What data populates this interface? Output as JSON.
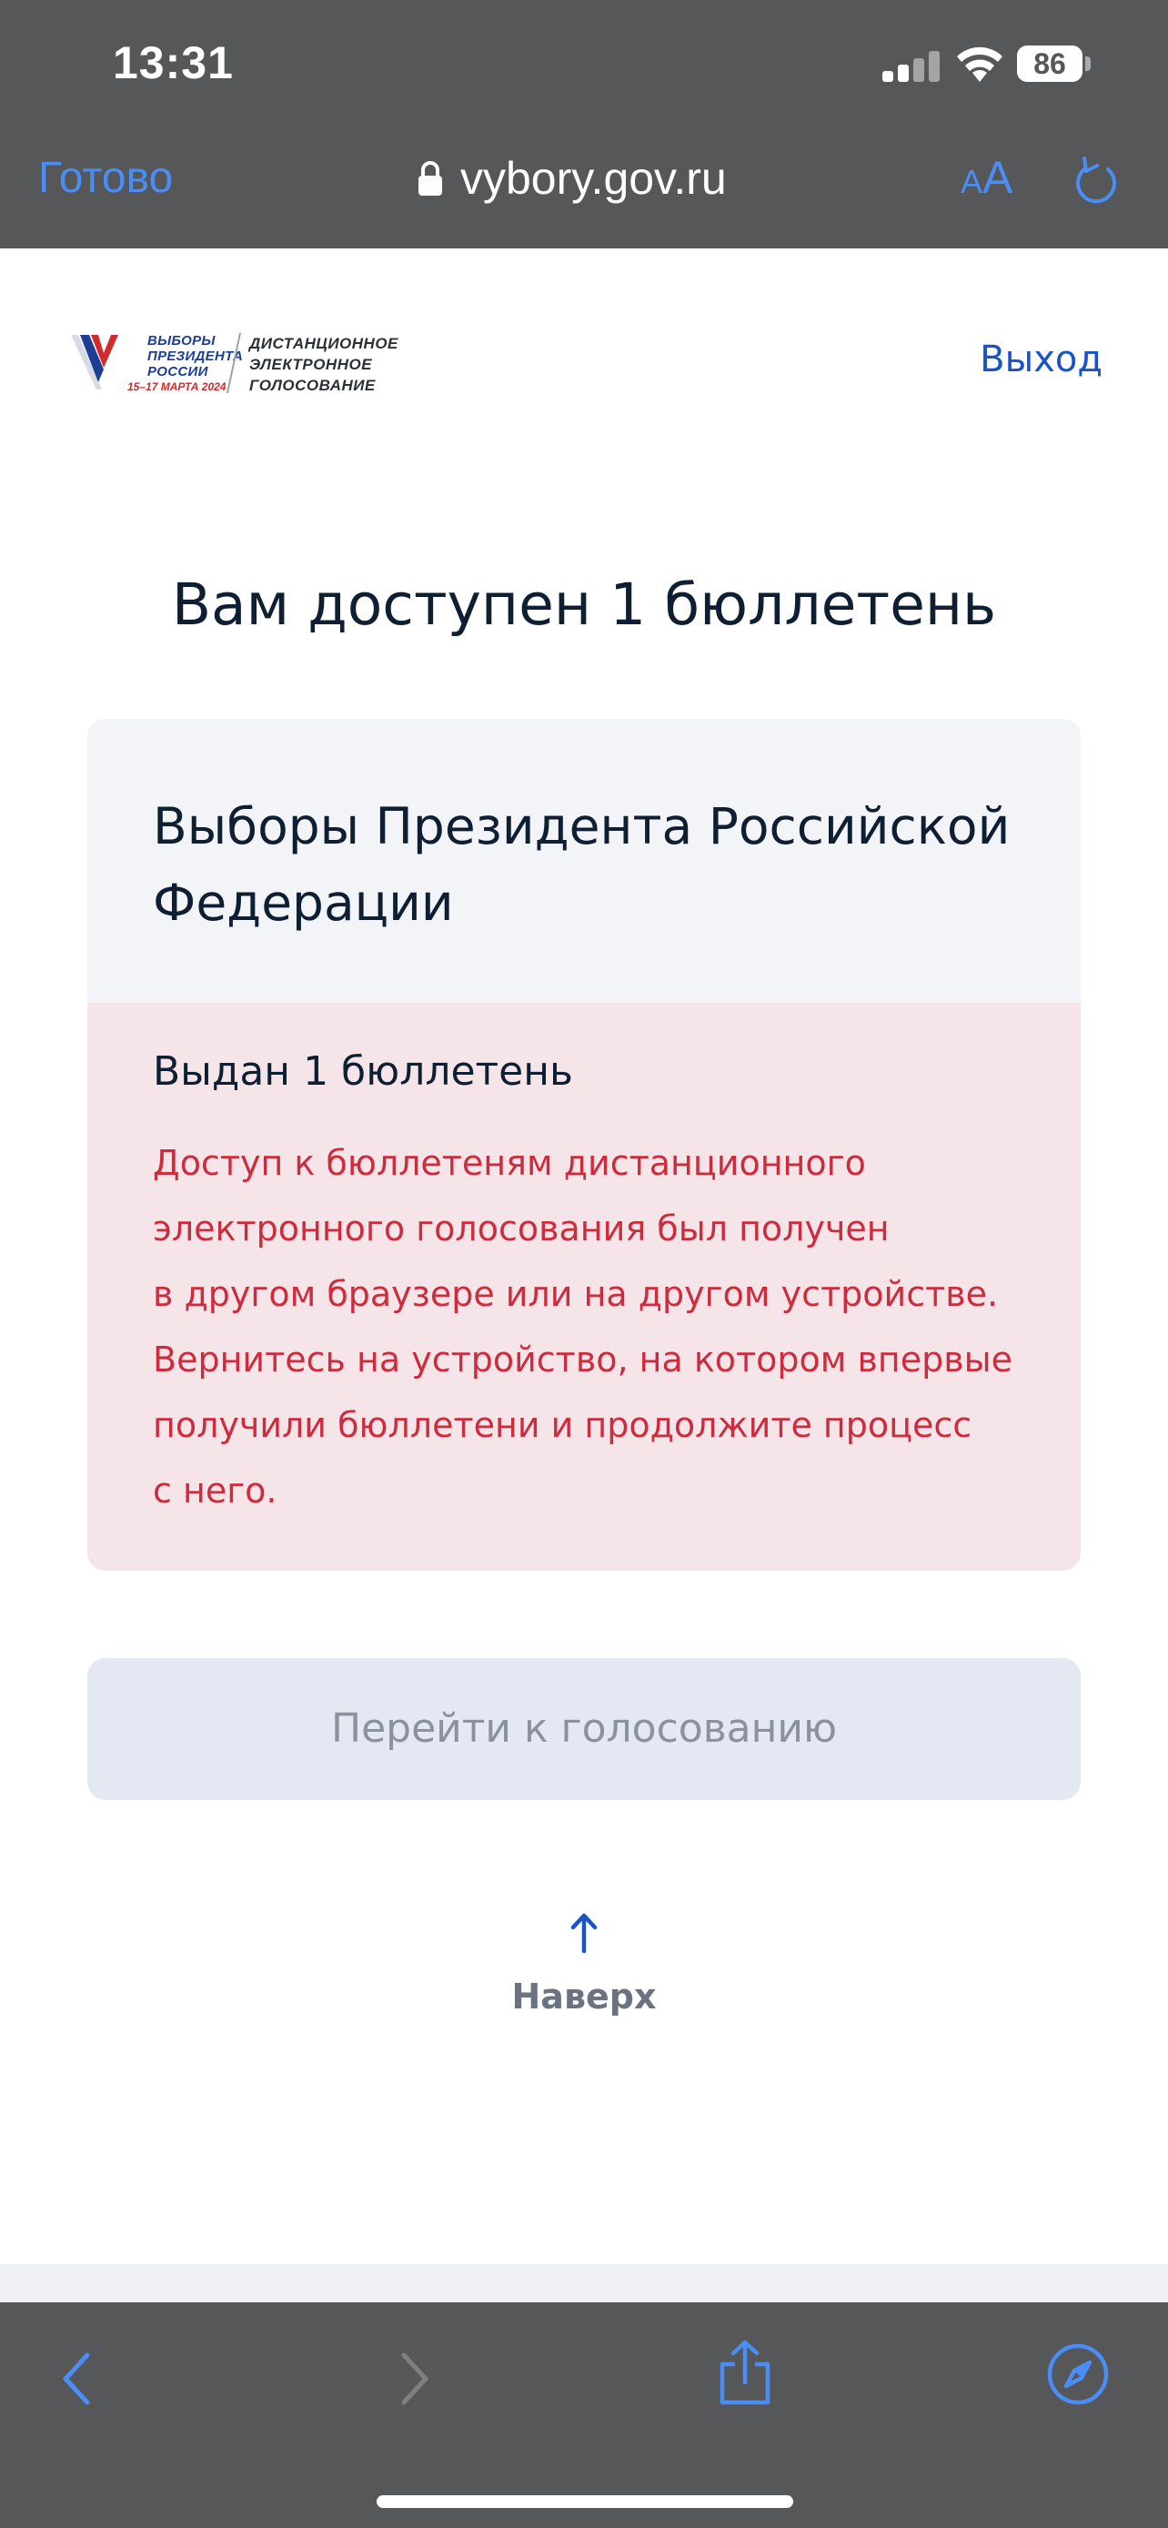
{
  "status_bar": {
    "time": "13:31",
    "battery": "86"
  },
  "browser": {
    "done_label": "Готово",
    "url": "vybory.gov.ru",
    "text_size_small": "A",
    "text_size_large": "A"
  },
  "header": {
    "logo_text_left": [
      "ВЫБОРЫ",
      "ПРЕЗИДЕНТА",
      "РОССИИ"
    ],
    "logo_date": "15–17 МАРТА 2024",
    "logo_text_right": [
      "ДИСТАНЦИОННОЕ",
      "ЭЛЕКТРОННОЕ",
      "ГОЛОСОВАНИЕ"
    ],
    "logout_label": "Выход"
  },
  "main": {
    "title": "Вам доступен 1 бюллетень",
    "card": {
      "title_lines": [
        "Выборы Президента Российской",
        "Федерации"
      ],
      "issued": "Выдан 1 бюллетень",
      "warning_lines": [
        "Доступ к бюллетеням дистанционного",
        "электронного голосования был получен",
        "в другом браузере или на другом устройстве.",
        "Вернитесь на устройство, на котором впервые",
        "получили бюллетени и продолжите процесс",
        "с него."
      ]
    },
    "vote_button": "Перейти к голосованию",
    "top_link": "Наверх"
  },
  "colors": {
    "chrome": "#565759",
    "ios_blue": "#4a8df5",
    "link_blue": "#1a52c9",
    "error_red": "#cc2c3d",
    "error_bg": "#f5e5e8",
    "card_bg": "#f3f4f8",
    "button_disabled_bg": "#e3e8f2"
  },
  "icons": {
    "lock": "lock-icon",
    "reload": "reload-icon",
    "back": "chevron-left-icon",
    "forward": "chevron-right-icon",
    "share": "share-icon",
    "compass": "compass-icon",
    "up": "arrow-up-icon"
  }
}
